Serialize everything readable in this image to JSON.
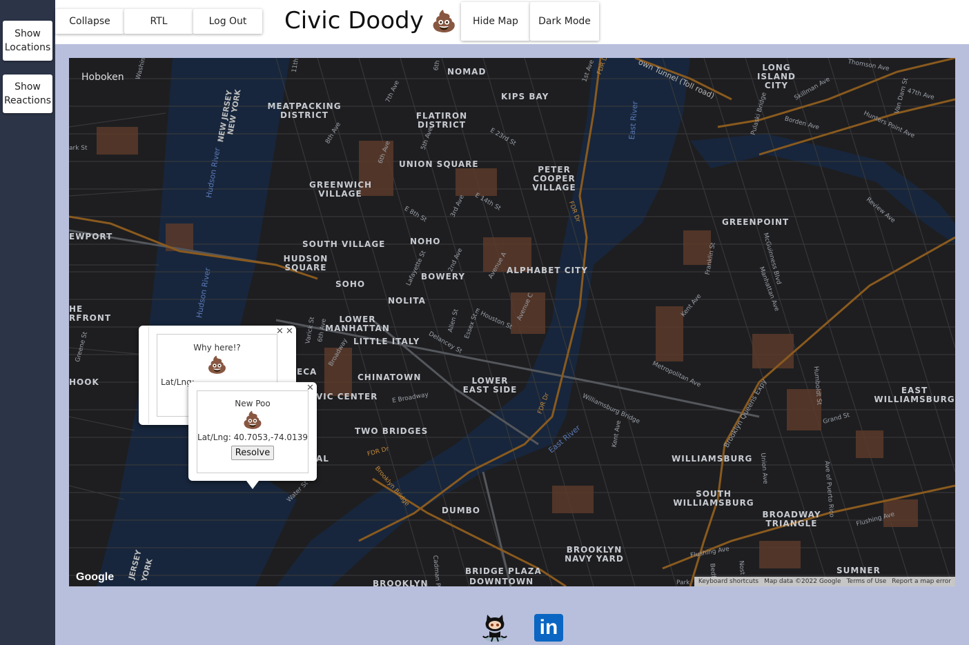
{
  "sidebar": {
    "show_locations": "Show Locations",
    "show_reactions": "Show Reactions"
  },
  "toolbar": {
    "collapse": "Collapse",
    "rtl": "RTL",
    "logout": "Log Out",
    "title": "Civic Doody",
    "title_emoji": "💩",
    "hide_map": "Hide Map",
    "dark_mode": "Dark Mode"
  },
  "map": {
    "neighborhoods": [
      "Hoboken",
      "MEATPACKING DISTRICT",
      "NOMAD",
      "KIPS BAY",
      "FLATIRON DISTRICT",
      "LONG ISLAND CITY",
      "UNION SQUARE",
      "PETER COOPER VILLAGE",
      "GREENWICH VILLAGE",
      "GREENPOINT",
      "SOUTH VILLAGE",
      "NOHO",
      "HUDSON SQUARE",
      "BOWERY",
      "ALPHABET CITY",
      "EWPORT",
      "SOHO",
      "NOLITA",
      "HE RFRONT",
      "LOWER MANHATTAN",
      "LITTLE ITALY",
      "CHINATOWN",
      "LOWER EAST SIDE",
      "ECA",
      "VIC CENTER",
      "HOOK",
      "EAST WILLIAMSBURG",
      "TWO BRIDGES",
      "WILLIAMSBURG",
      "SOUTH WILLIAMSBURG",
      "DUMBO",
      "BROADWAY TRIANGLE",
      "BROOKLYN NAVY YARD",
      "BRIDGE PLAZA",
      "DOWNTOWN",
      "SUMNER",
      "BROOKLYN",
      "AL"
    ],
    "streets": [
      "Washing",
      "11th",
      "6th",
      "1st Ave",
      "FDR Dr",
      "own Tunnel (Toll road)",
      "Thomson Ave",
      "7th Ave",
      "Skillman Ave",
      "47th Ave",
      "Van Dam St",
      "ark St",
      "NEW JERSEY",
      "NEW YORK",
      "8th Ave",
      "E 23rd St",
      "Pulaski Bridge",
      "Borden Ave",
      "Hunters Point Ave",
      "6th Ave",
      "5th Ave",
      "Hudson River",
      "3rd Ave",
      "E 14th St",
      "FDR Dr",
      "Review Ave",
      "E 8th St",
      "Franklin St",
      "McGuinness Blvd",
      "2nd Ave",
      "Lafayette St",
      "Avenue A",
      "Manhattan Ave",
      "Kent Ave",
      "Greene St",
      "Varick St",
      "Allen St",
      "E Houston St",
      "Avenue C",
      "6th Ave",
      "Broadway",
      "Essex St",
      "Delancey St",
      "Metropolitan Ave",
      "Brooklyn Queens Expy",
      "Humboldt St",
      "E Broadway",
      "Williamsburg Bridge",
      "Grand St",
      "FDR Dr",
      "Kent Ave",
      "Union Ave",
      "FDR Dr",
      "Brooklyn Bridge",
      "Water St",
      "Ave of Puerto Rico",
      "Flushing Ave",
      "Cadman Pl",
      "Flushing Ave",
      "Nost",
      "Bedf",
      "JERSEY",
      "YORK",
      "Park"
    ],
    "water": [
      "East River",
      "East River",
      "Hudson River"
    ],
    "attribution": {
      "logo": "Google",
      "shortcuts": "Keyboard shortcuts",
      "data": "Map data ©2022 Google",
      "terms": "Terms of Use",
      "report": "Report a map error"
    }
  },
  "popups": {
    "back": {
      "title": "Why here!?",
      "emoji": "💩",
      "latlng_prefix": "Lat/Lng:"
    },
    "front": {
      "title": "New Poo",
      "emoji": "💩",
      "latlng": "Lat/Lng: 40.7053,-74.0139",
      "resolve": "Resolve"
    }
  },
  "colors": {
    "map_land": "#1d1d1f",
    "map_water": "#17263c",
    "highway": "#8a5a1e",
    "park_brown": "#5b3a2a"
  },
  "footer": {
    "icons": [
      "github-octocat-icon",
      "linkedin-icon"
    ],
    "linkedin_text": "in"
  }
}
